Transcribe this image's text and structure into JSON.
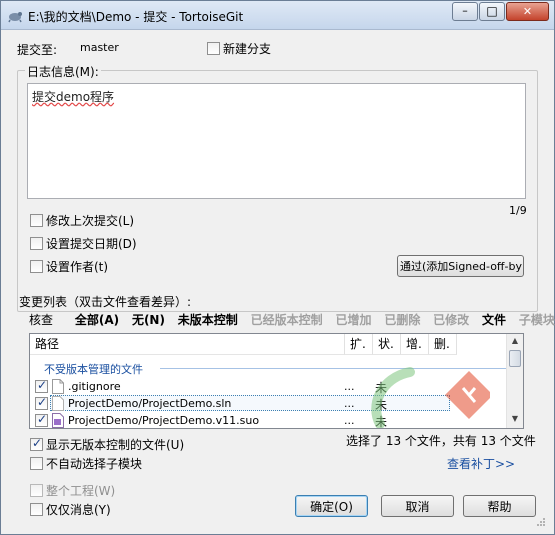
{
  "window": {
    "title": "E:\\我的文档\\Demo - 提交 - TortoiseGit",
    "controls": {
      "minimize": "–",
      "maximize": "□",
      "close": "✕"
    }
  },
  "commit_to": {
    "label": "提交至:",
    "branch": "master",
    "new_branch_label": "新建分支",
    "new_branch_checked": false
  },
  "log": {
    "label": "日志信息(M):",
    "text": "提交demo程序",
    "counter": "1/9"
  },
  "options": {
    "amend_label": "修改上次提交(L)",
    "set_date_label": "设置提交日期(D)",
    "set_author_label": "设置作者(t)",
    "signed_off_label": "通过(添加Signed-off-by"
  },
  "changes": {
    "label": "变更列表（双击文件查看差异）:",
    "filters": {
      "check": "核查",
      "all": "全部(A)",
      "none": "无(N)",
      "unversioned": "未版本控制",
      "versioned": "已经版本控制",
      "added": "已增加",
      "deleted": "已删除",
      "modified": "已修改",
      "files": "文件",
      "submodules": "子模块"
    },
    "columns": [
      "路径",
      "扩.",
      "状.",
      "增.",
      "删."
    ],
    "group_label": "不受版本管理的文件",
    "files": [
      {
        "name": ".gitignore",
        "ext": "...",
        "status": "未",
        "checked": true,
        "selected": false
      },
      {
        "name": "ProjectDemo/ProjectDemo.sln",
        "ext": "...",
        "status": "未",
        "checked": true,
        "selected": true
      },
      {
        "name": "ProjectDemo/ProjectDemo.v11.suo",
        "ext": "...",
        "status": "未",
        "checked": true,
        "selected": false
      }
    ],
    "summary": "选择了 13 个文件，共有 13 个文件",
    "show_unversioned_label": "显示无版本控制的文件(U)",
    "show_unversioned_checked": true,
    "no_autoselect_submodules_label": "不自动选择子模块",
    "no_autoselect_submodules_checked": false,
    "view_patch_link": "查看补丁>>"
  },
  "bottom": {
    "whole_project_label": "整个工程(W)",
    "message_only_label": "仅仅消息(Y)",
    "ok_label": "确定(O)",
    "cancel_label": "取消",
    "help_label": "帮助"
  },
  "colors": {
    "accent_link": "#1a4fa0",
    "selection_border": "#3c7fb1",
    "git_logo_red": "#e24b2b",
    "watermark_green": "#7fc67f"
  }
}
